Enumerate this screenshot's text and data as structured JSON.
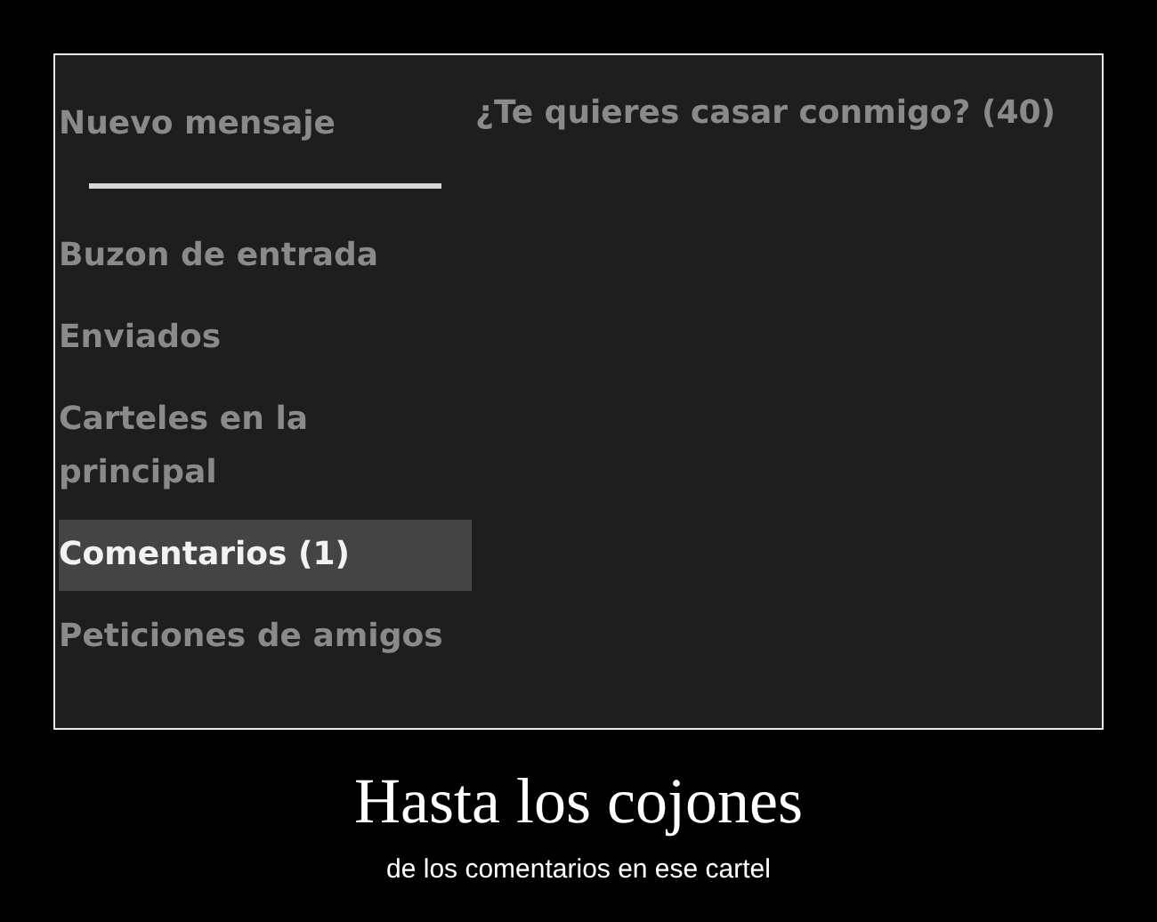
{
  "sidebar": {
    "new_message": "Nuevo mensaje",
    "items": [
      {
        "label": "Buzon de entrada",
        "selected": false
      },
      {
        "label": "Enviados",
        "selected": false
      },
      {
        "label": "Carteles en la principal",
        "selected": false
      },
      {
        "label": "Comentarios (1)",
        "selected": true
      },
      {
        "label": "Peticiones de amigos",
        "selected": false
      }
    ]
  },
  "content": {
    "title": "¿Te quieres casar conmigo? (40)"
  },
  "caption": {
    "title": "Hasta los cojones",
    "subtitle": "de los comentarios en ese cartel"
  }
}
